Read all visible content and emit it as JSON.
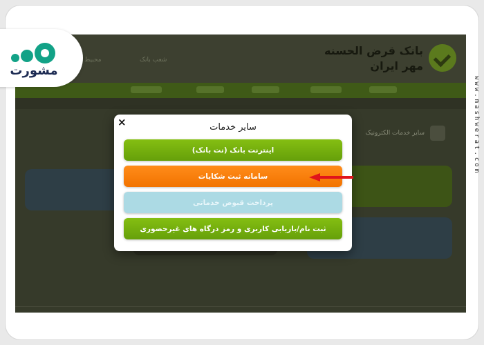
{
  "brand": {
    "name": "مشورت"
  },
  "side_url": "www.mashwerat.com",
  "background": {
    "bank_name_line1": "بانک قرض الحسنه",
    "bank_name_line2": "مهر ایران",
    "top_links": [
      "شعب بانک",
      "محبیط"
    ],
    "breadcrumb": "سایر خدمات الکترونیک"
  },
  "modal": {
    "title": "سایر خدمات",
    "close_symbol": "×",
    "buttons": [
      {
        "label": "اینترنت بانک (نت بانک)",
        "color": "#74ad0d"
      },
      {
        "label": "سامانه ثبت شکایات",
        "color": "#f57d00"
      },
      {
        "label": "پرداخت قبوض خدماتی",
        "color": "#acdae4"
      },
      {
        "label": "ثبت نام/بازیابی کاربری و رمز درگاه های غیرحضوری",
        "color": "#74ad0d"
      }
    ]
  },
  "annotation": {
    "arrow_color": "#e0141b",
    "points_to": "سامانه ثبت شکایات"
  },
  "colors": {
    "brand_accent": "#12a287",
    "brand_text": "#1d2b53"
  }
}
